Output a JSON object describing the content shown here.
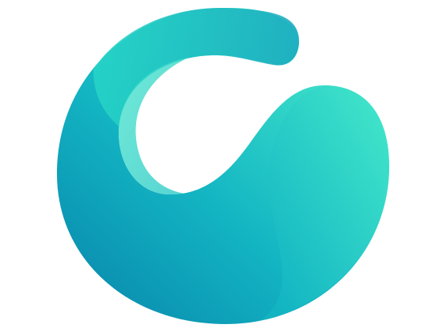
{
  "logo": {
    "icon": "teal-swirl-logo-icon",
    "colors": {
      "deep_teal": "#0a8fb0",
      "teal": "#13b5c3",
      "aqua": "#27d6c6",
      "mint": "#3fe3c9",
      "arc_dark": "#1aa8bf"
    }
  }
}
